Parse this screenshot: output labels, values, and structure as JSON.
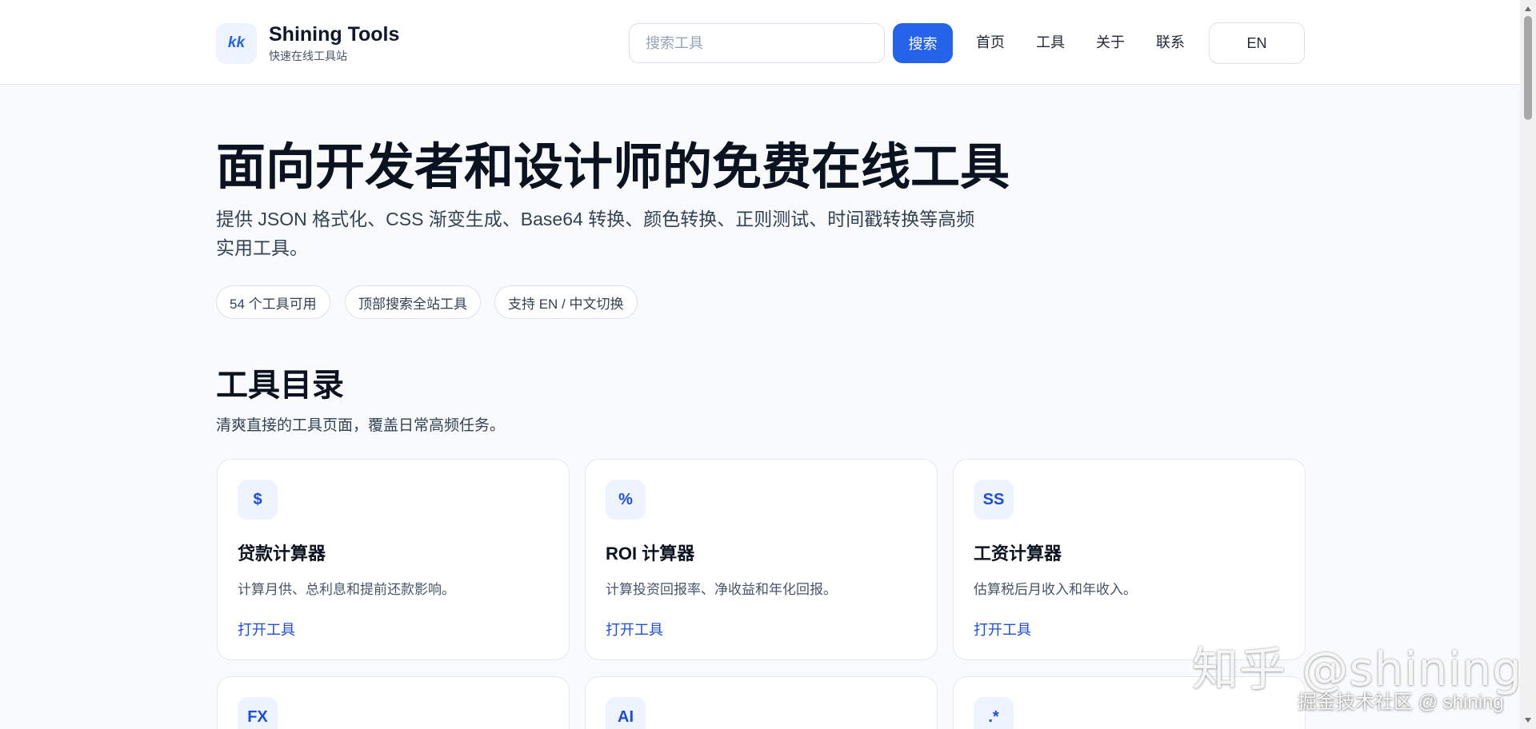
{
  "header": {
    "logo_text": "kk",
    "brand_name": "Shining Tools",
    "brand_sub": "快速在线工具站",
    "search_placeholder": "搜索工具",
    "search_button": "搜索",
    "nav": [
      "首页",
      "工具",
      "关于",
      "联系"
    ],
    "lang": "EN"
  },
  "hero": {
    "title": "面向开发者和设计师的免费在线工具",
    "description": "提供 JSON 格式化、CSS 渐变生成、Base64 转换、颜色转换、正则测试、时间戳转换等高频实用工具。",
    "chips": [
      "54 个工具可用",
      "顶部搜索全站工具",
      "支持 EN / 中文切换"
    ]
  },
  "section": {
    "title": "工具目录",
    "subtitle": "清爽直接的工具页面，覆盖日常高频任务。"
  },
  "cards": [
    {
      "icon": "$",
      "title": "贷款计算器",
      "desc": "计算月供、总利息和提前还款影响。",
      "link": "打开工具"
    },
    {
      "icon": "%",
      "title": "ROI 计算器",
      "desc": "计算投资回报率、净收益和年化回报。",
      "link": "打开工具"
    },
    {
      "icon": "SS",
      "title": "工资计算器",
      "desc": "估算税后月收入和年收入。",
      "link": "打开工具"
    },
    {
      "icon": "FX"
    },
    {
      "icon": "AI"
    },
    {
      "icon": ".*"
    }
  ],
  "watermark": {
    "main": "知乎 @shining",
    "sub": "掘金技术社区 @ shining"
  },
  "colors": {
    "accent": "#2563eb",
    "background": "#f8fafc",
    "card_bg": "#ffffff",
    "icon_bg": "#eef4ff"
  }
}
